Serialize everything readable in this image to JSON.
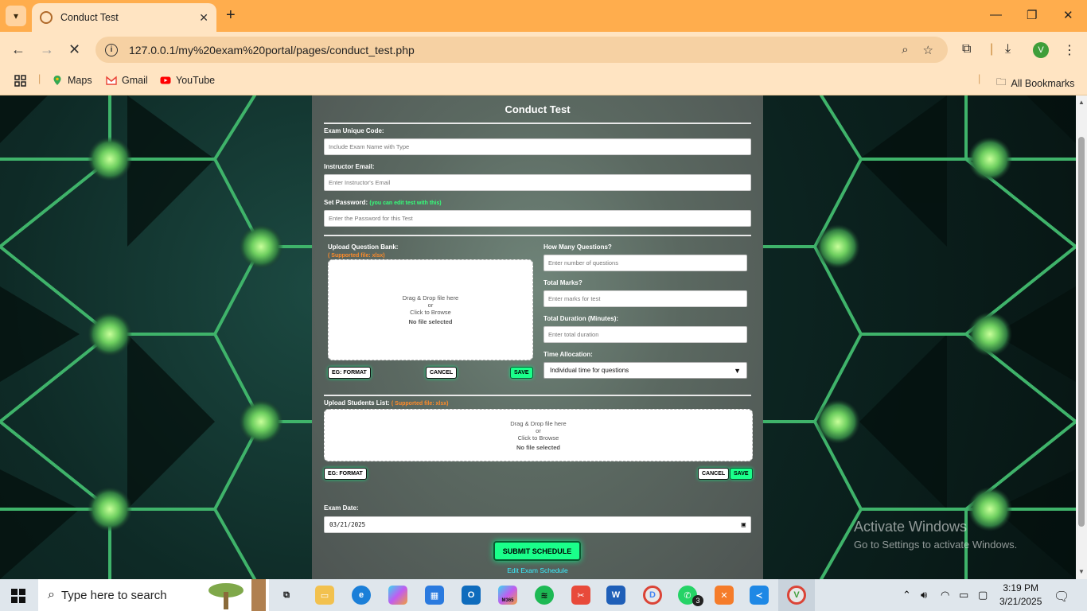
{
  "browser": {
    "tab_title": "Conduct Test",
    "url": "127.0.0.1/my%20exam%20portal/pages/conduct_test.php",
    "avatar_letter": "V",
    "bookmarks": [
      {
        "label": "Maps"
      },
      {
        "label": "Gmail"
      },
      {
        "label": "YouTube"
      }
    ],
    "all_bookmarks": "All Bookmarks"
  },
  "form": {
    "title": "Conduct Test",
    "exam_code": {
      "label": "Exam Unique Code:",
      "placeholder": "Include Exam Name with Type"
    },
    "instructor_email": {
      "label": "Instructor Email:",
      "placeholder": "Enter Instructor's Email"
    },
    "password": {
      "label": "Set Password:",
      "hint": "(you can edit test with this)",
      "placeholder": "Enter the Password for this Test"
    },
    "question_bank": {
      "label": "Upload Question Bank:",
      "supported": "( Supported file: xlsx)",
      "drop_line1": "Drag & Drop file here",
      "drop_line2": "or",
      "drop_line3": "Click to Browse",
      "no_file": "No file selected",
      "eg_format": "EG: FORMAT",
      "cancel": "CANCEL",
      "save": "SAVE"
    },
    "num_questions": {
      "label": "How Many Questions?",
      "placeholder": "Enter number of questions"
    },
    "total_marks": {
      "label": "Total Marks?",
      "placeholder": "Enter marks for test"
    },
    "duration": {
      "label": "Total Duration (Minutes):",
      "placeholder": "Enter total duration"
    },
    "time_allocation": {
      "label": "Time Allocation:",
      "selected": "Individual time for questions"
    },
    "students_list": {
      "label": "Upload Students List:",
      "supported": "( Supported file: xlsx)",
      "drop_line1": "Drag & Drop file here",
      "drop_line2": "or",
      "drop_line3": "Click to Browse",
      "no_file": "No file selected",
      "eg_format": "EG: FORMAT",
      "cancel": "CANCEL",
      "save": "SAVE"
    },
    "exam_date": {
      "label": "Exam Date:",
      "value": "03/21/2025"
    },
    "submit": "SUBMIT SCHEDULE",
    "edit_link": "Edit Exam Schedule"
  },
  "watermark": {
    "line1": "Activate Windows",
    "line2": "Go to Settings to activate Windows."
  },
  "taskbar": {
    "search_placeholder": "Type here to search",
    "whatsapp_badge": "3",
    "m365_label": "M365",
    "time": "3:19 PM",
    "date": "3/21/2025"
  },
  "colors": {
    "tabbar": "#ffad4d",
    "toolbar": "#ffe4c2",
    "accent_green": "#1aff8a",
    "hint_green": "#35ff7a",
    "warn_orange": "#ff8c2a",
    "link_cyan": "#3af0ff"
  }
}
